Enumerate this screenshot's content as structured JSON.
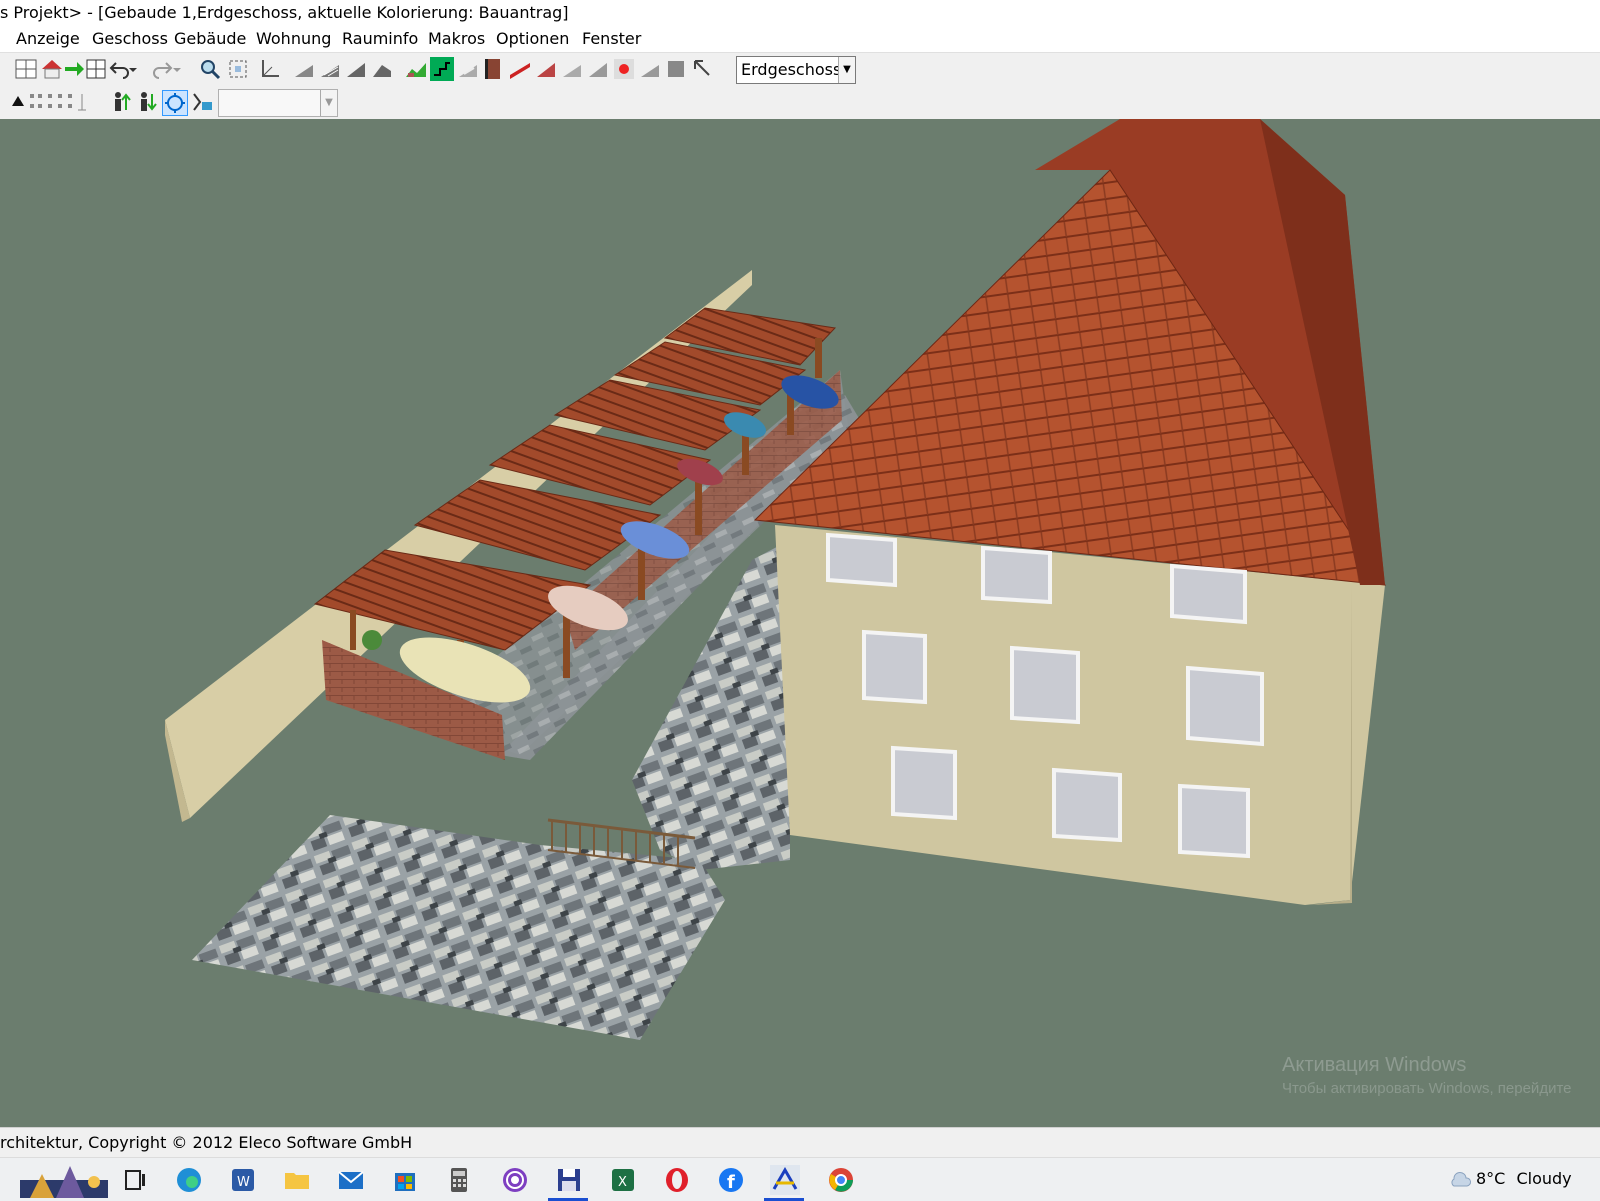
{
  "window": {
    "title": "s Projekt> - [Gebaude 1,Erdgeschoss, aktuelle Kolorierung: Bauantrag]"
  },
  "menu": {
    "items": [
      "Anzeige",
      "Geschoss",
      "Gebäude",
      "Wohnung",
      "Rauminfo",
      "Makros",
      "Optionen",
      "Fenster"
    ]
  },
  "toolbar": {
    "floor_select_value": "Erdgeschoss",
    "second_combo_value": ""
  },
  "viewport": {
    "background_color": "#6b7d6e",
    "watermark_line1": "Активация Windows",
    "watermark_line2": "Чтобы активировать Windows, перейдите"
  },
  "statusbar": {
    "text": "rchitektur, Copyright © 2012 Eleco Software GmbH"
  },
  "taskbar": {
    "icons": [
      "widgets-icon",
      "task-view-icon",
      "edge-icon",
      "word-icon",
      "file-explorer-icon",
      "mail-icon",
      "store-icon",
      "calculator-icon",
      "tor-browser-icon",
      "save-app-icon",
      "excel-icon",
      "opera-icon",
      "facebook-icon",
      "arcon-icon",
      "chrome-icon"
    ],
    "weather_temp": "8°C",
    "weather_text": "Cloudy"
  }
}
